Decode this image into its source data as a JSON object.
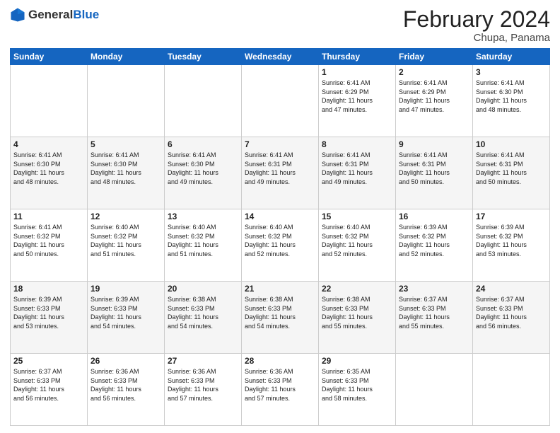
{
  "header": {
    "logo_general": "General",
    "logo_blue": "Blue",
    "title": "February 2024",
    "subtitle": "Chupa, Panama"
  },
  "days_of_week": [
    "Sunday",
    "Monday",
    "Tuesday",
    "Wednesday",
    "Thursday",
    "Friday",
    "Saturday"
  ],
  "weeks": [
    [
      {
        "day": "",
        "info": ""
      },
      {
        "day": "",
        "info": ""
      },
      {
        "day": "",
        "info": ""
      },
      {
        "day": "",
        "info": ""
      },
      {
        "day": "1",
        "info": "Sunrise: 6:41 AM\nSunset: 6:29 PM\nDaylight: 11 hours\nand 47 minutes."
      },
      {
        "day": "2",
        "info": "Sunrise: 6:41 AM\nSunset: 6:29 PM\nDaylight: 11 hours\nand 47 minutes."
      },
      {
        "day": "3",
        "info": "Sunrise: 6:41 AM\nSunset: 6:30 PM\nDaylight: 11 hours\nand 48 minutes."
      }
    ],
    [
      {
        "day": "4",
        "info": "Sunrise: 6:41 AM\nSunset: 6:30 PM\nDaylight: 11 hours\nand 48 minutes."
      },
      {
        "day": "5",
        "info": "Sunrise: 6:41 AM\nSunset: 6:30 PM\nDaylight: 11 hours\nand 48 minutes."
      },
      {
        "day": "6",
        "info": "Sunrise: 6:41 AM\nSunset: 6:30 PM\nDaylight: 11 hours\nand 49 minutes."
      },
      {
        "day": "7",
        "info": "Sunrise: 6:41 AM\nSunset: 6:31 PM\nDaylight: 11 hours\nand 49 minutes."
      },
      {
        "day": "8",
        "info": "Sunrise: 6:41 AM\nSunset: 6:31 PM\nDaylight: 11 hours\nand 49 minutes."
      },
      {
        "day": "9",
        "info": "Sunrise: 6:41 AM\nSunset: 6:31 PM\nDaylight: 11 hours\nand 50 minutes."
      },
      {
        "day": "10",
        "info": "Sunrise: 6:41 AM\nSunset: 6:31 PM\nDaylight: 11 hours\nand 50 minutes."
      }
    ],
    [
      {
        "day": "11",
        "info": "Sunrise: 6:41 AM\nSunset: 6:32 PM\nDaylight: 11 hours\nand 50 minutes."
      },
      {
        "day": "12",
        "info": "Sunrise: 6:40 AM\nSunset: 6:32 PM\nDaylight: 11 hours\nand 51 minutes."
      },
      {
        "day": "13",
        "info": "Sunrise: 6:40 AM\nSunset: 6:32 PM\nDaylight: 11 hours\nand 51 minutes."
      },
      {
        "day": "14",
        "info": "Sunrise: 6:40 AM\nSunset: 6:32 PM\nDaylight: 11 hours\nand 52 minutes."
      },
      {
        "day": "15",
        "info": "Sunrise: 6:40 AM\nSunset: 6:32 PM\nDaylight: 11 hours\nand 52 minutes."
      },
      {
        "day": "16",
        "info": "Sunrise: 6:39 AM\nSunset: 6:32 PM\nDaylight: 11 hours\nand 52 minutes."
      },
      {
        "day": "17",
        "info": "Sunrise: 6:39 AM\nSunset: 6:32 PM\nDaylight: 11 hours\nand 53 minutes."
      }
    ],
    [
      {
        "day": "18",
        "info": "Sunrise: 6:39 AM\nSunset: 6:33 PM\nDaylight: 11 hours\nand 53 minutes."
      },
      {
        "day": "19",
        "info": "Sunrise: 6:39 AM\nSunset: 6:33 PM\nDaylight: 11 hours\nand 54 minutes."
      },
      {
        "day": "20",
        "info": "Sunrise: 6:38 AM\nSunset: 6:33 PM\nDaylight: 11 hours\nand 54 minutes."
      },
      {
        "day": "21",
        "info": "Sunrise: 6:38 AM\nSunset: 6:33 PM\nDaylight: 11 hours\nand 54 minutes."
      },
      {
        "day": "22",
        "info": "Sunrise: 6:38 AM\nSunset: 6:33 PM\nDaylight: 11 hours\nand 55 minutes."
      },
      {
        "day": "23",
        "info": "Sunrise: 6:37 AM\nSunset: 6:33 PM\nDaylight: 11 hours\nand 55 minutes."
      },
      {
        "day": "24",
        "info": "Sunrise: 6:37 AM\nSunset: 6:33 PM\nDaylight: 11 hours\nand 56 minutes."
      }
    ],
    [
      {
        "day": "25",
        "info": "Sunrise: 6:37 AM\nSunset: 6:33 PM\nDaylight: 11 hours\nand 56 minutes."
      },
      {
        "day": "26",
        "info": "Sunrise: 6:36 AM\nSunset: 6:33 PM\nDaylight: 11 hours\nand 56 minutes."
      },
      {
        "day": "27",
        "info": "Sunrise: 6:36 AM\nSunset: 6:33 PM\nDaylight: 11 hours\nand 57 minutes."
      },
      {
        "day": "28",
        "info": "Sunrise: 6:36 AM\nSunset: 6:33 PM\nDaylight: 11 hours\nand 57 minutes."
      },
      {
        "day": "29",
        "info": "Sunrise: 6:35 AM\nSunset: 6:33 PM\nDaylight: 11 hours\nand 58 minutes."
      },
      {
        "day": "",
        "info": ""
      },
      {
        "day": "",
        "info": ""
      }
    ]
  ]
}
